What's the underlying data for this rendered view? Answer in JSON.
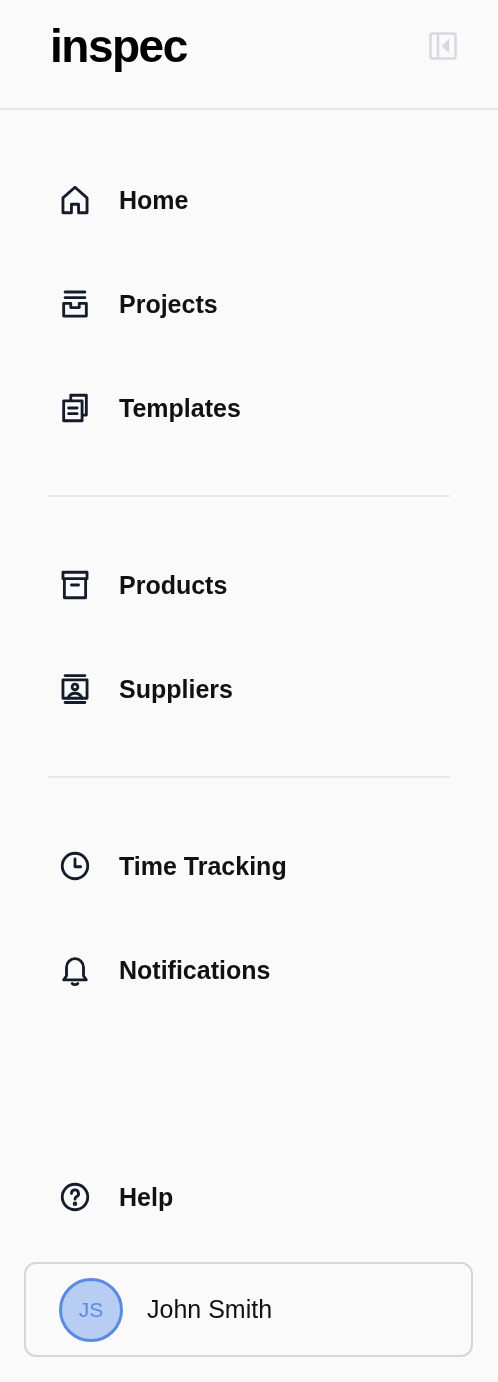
{
  "sidebar": {
    "logo": "inspec",
    "groups": [
      {
        "items": [
          {
            "label": "Home"
          },
          {
            "label": "Projects"
          },
          {
            "label": "Templates"
          }
        ]
      },
      {
        "items": [
          {
            "label": "Products"
          },
          {
            "label": "Suppliers"
          }
        ]
      },
      {
        "items": [
          {
            "label": "Time Tracking"
          },
          {
            "label": "Notifications"
          }
        ]
      }
    ],
    "footer_items": [
      {
        "label": "Help"
      }
    ],
    "user": {
      "initials": "JS",
      "name": "John Smith"
    }
  }
}
